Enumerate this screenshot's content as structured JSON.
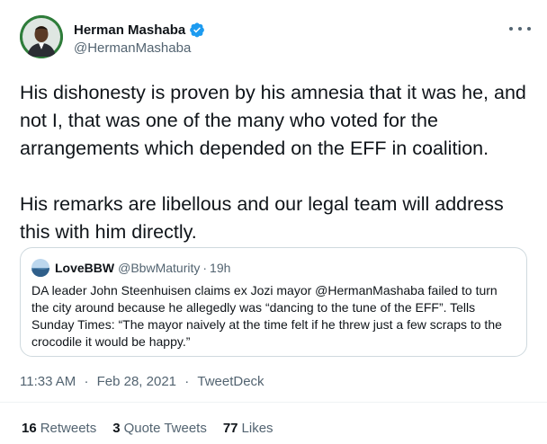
{
  "author": {
    "name": "Herman Mashaba",
    "handle": "@HermanMashaba"
  },
  "tweet": {
    "paragraphs": [
      "His dishonesty is proven by his amnesia that it was he, and not I, that was one of the many who voted for the arrangements which depended on the EFF in coalition.",
      "His remarks are libellous and our legal team will address this with him directly."
    ]
  },
  "quoted_tweet": {
    "name": "LoveBBW",
    "handle": "@BbwMaturity",
    "separator": "·",
    "time": "19h",
    "text": "DA leader John Steenhuisen claims ex Jozi mayor @HermanMashaba failed to turn the city around because he allegedly was “dancing to the tune of the EFF”. Tells Sunday Times: “The mayor naively at the time felt if he threw just a few scraps to the crocodile it would be happy.”"
  },
  "meta": {
    "time": "11:33 AM",
    "separator": "·",
    "date": "Feb 28, 2021",
    "source": "TweetDeck"
  },
  "stats": {
    "retweets_count": "16",
    "retweets_label": "Retweets",
    "quotes_count": "3",
    "quotes_label": "Quote Tweets",
    "likes_count": "77",
    "likes_label": "Likes"
  },
  "colors": {
    "verified": "#1d9bf0",
    "secondary_text": "#536471",
    "border": "#cfd9de"
  }
}
